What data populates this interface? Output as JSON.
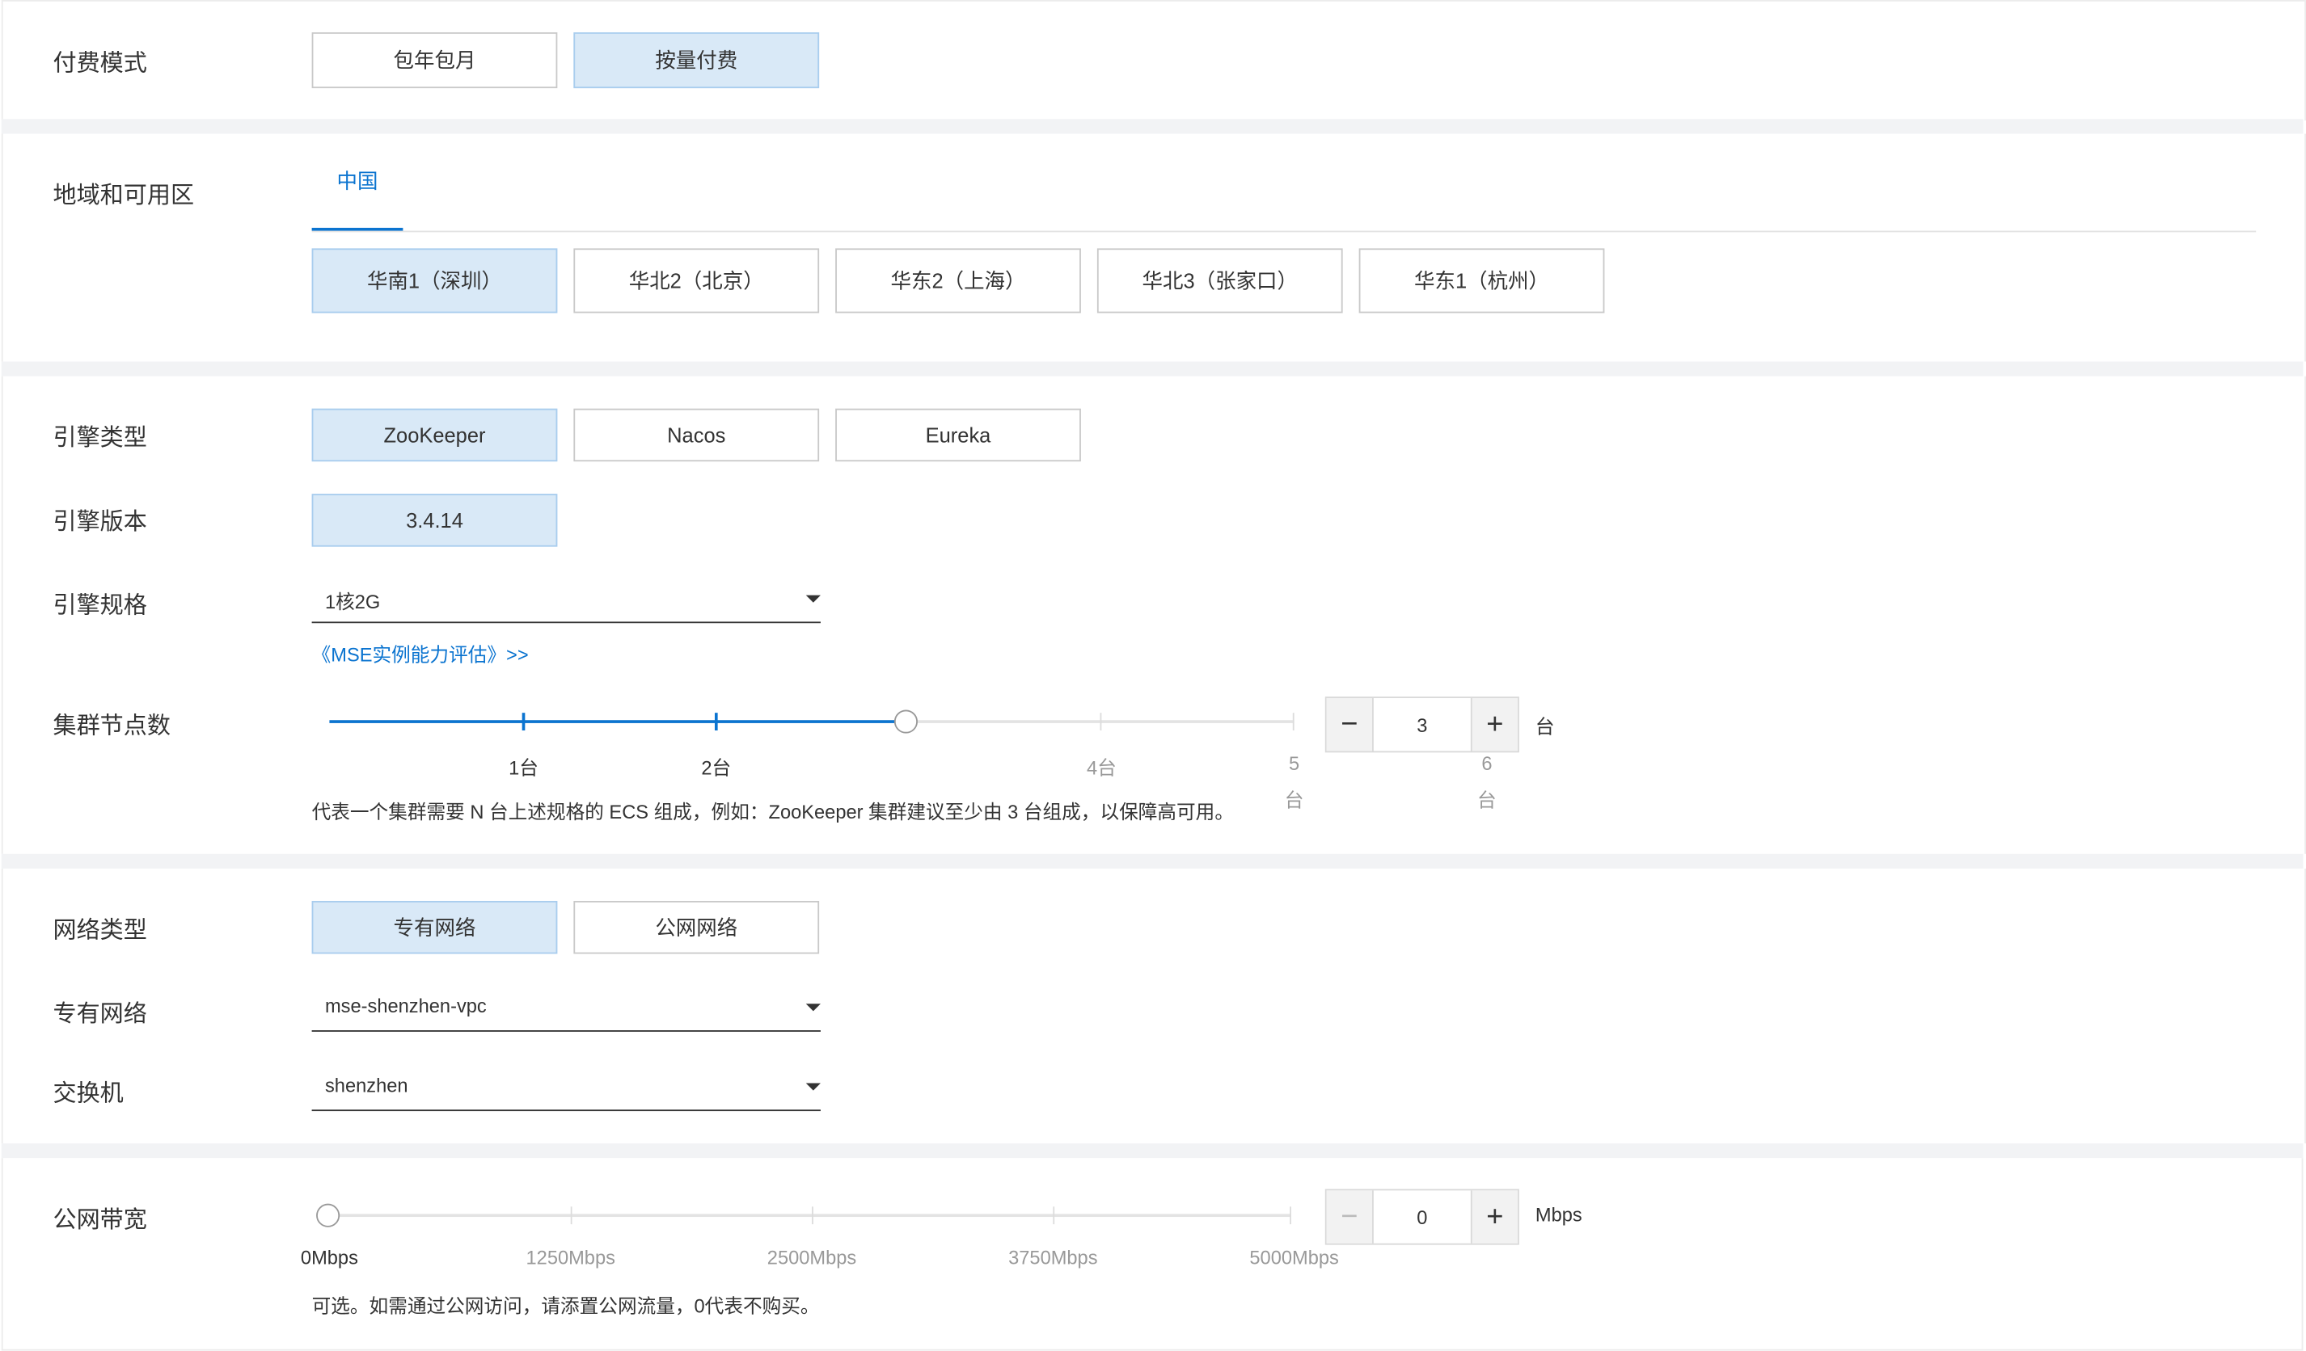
{
  "billing": {
    "label": "付费模式",
    "options": [
      "包年包月",
      "按量付费"
    ],
    "selected": "按量付费"
  },
  "region": {
    "label": "地域和可用区",
    "tab": "中国",
    "options": [
      "华南1（深圳）",
      "华北2（北京）",
      "华东2（上海）",
      "华北3（张家口）",
      "华东1（杭州）"
    ],
    "selected": "华南1（深圳）"
  },
  "engine": {
    "type_label": "引擎类型",
    "types": [
      "ZooKeeper",
      "Nacos",
      "Eureka"
    ],
    "selected_type": "ZooKeeper",
    "version_label": "引擎版本",
    "version": "3.4.14",
    "spec_label": "引擎规格",
    "spec_value": "1核2G",
    "eval_link": "《MSE实例能力评估》>>"
  },
  "nodes": {
    "label": "集群节点数",
    "ticks": [
      "1台",
      "2台",
      "4台",
      "5",
      "台",
      "6",
      "台"
    ],
    "value": "3",
    "unit": "台",
    "level": 3,
    "help": "代表一个集群需要 N 台上述规格的 ECS 组成，例如：ZooKeeper 集群建议至少由 3 台组成，以保障高可用。",
    "minus": "−",
    "plus": "+"
  },
  "network": {
    "type_label": "网络类型",
    "types": [
      "专有网络",
      "公网网络"
    ],
    "selected_type": "专有网络",
    "vpc_label": "专有网络",
    "vpc_value": "mse-shenzhen-vpc",
    "switch_label": "交换机",
    "switch_value": "shenzhen"
  },
  "bandwidth": {
    "label": "公网带宽",
    "ticks": [
      "0Mbps",
      "1250Mbps",
      "2500Mbps",
      "3750Mbps",
      "5000Mbps"
    ],
    "value": "0",
    "unit": "Mbps",
    "help": "可选。如需通过公网访问，请添置公网流量，0代表不购买。",
    "minus": "−",
    "plus": "+"
  },
  "colors": {
    "accent": "#0b74d0",
    "selected_bg": "#d9e9f7",
    "gap_bg": "#f2f3f5"
  }
}
